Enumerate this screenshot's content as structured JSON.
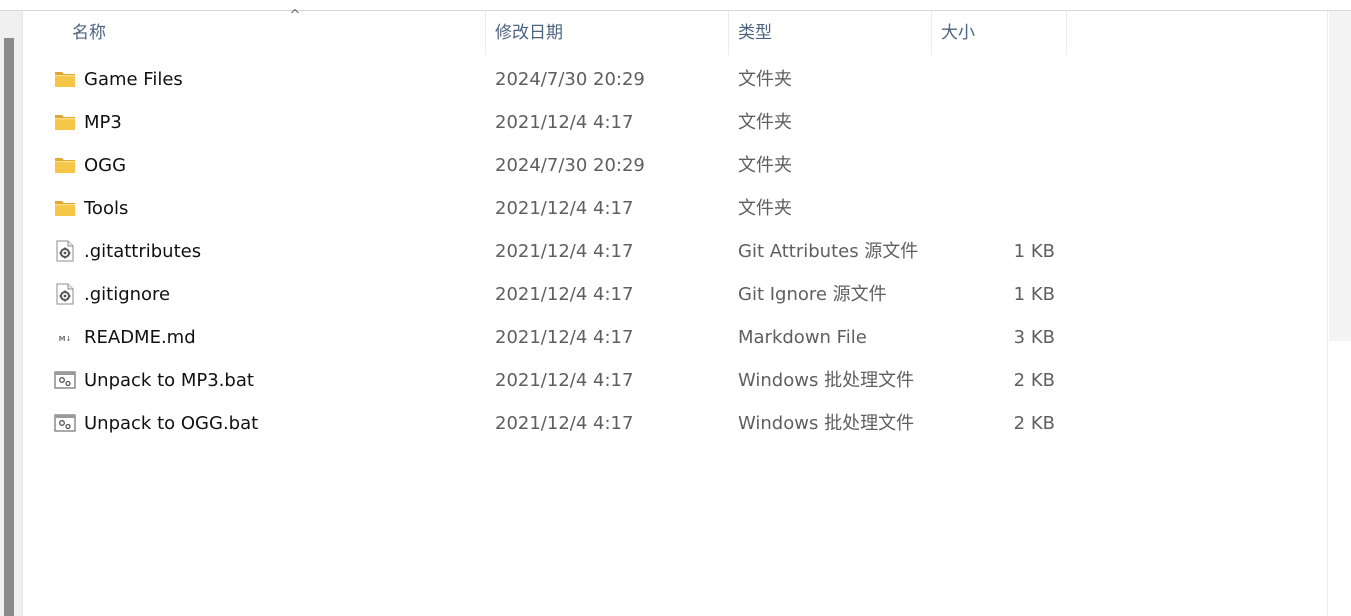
{
  "columns": {
    "name": "名称",
    "date": "修改日期",
    "type": "类型",
    "size": "大小"
  },
  "colors": {
    "folder": "#f6c648",
    "folder_dark": "#e0a82e",
    "header_text": "#4d6480"
  },
  "files": [
    {
      "name": "Game Files",
      "date": "2024/7/30 20:29",
      "type": "文件夹",
      "size": "",
      "icon": "folder-icon"
    },
    {
      "name": "MP3",
      "date": "2021/12/4 4:17",
      "type": "文件夹",
      "size": "",
      "icon": "folder-icon"
    },
    {
      "name": "OGG",
      "date": "2024/7/30 20:29",
      "type": "文件夹",
      "size": "",
      "icon": "folder-icon"
    },
    {
      "name": "Tools",
      "date": "2021/12/4 4:17",
      "type": "文件夹",
      "size": "",
      "icon": "folder-icon"
    },
    {
      "name": ".gitattributes",
      "date": "2021/12/4 4:17",
      "type": "Git Attributes 源文件",
      "size": "1 KB",
      "icon": "config-file-icon"
    },
    {
      "name": ".gitignore",
      "date": "2021/12/4 4:17",
      "type": "Git Ignore 源文件",
      "size": "1 KB",
      "icon": "config-file-icon"
    },
    {
      "name": "README.md",
      "date": "2021/12/4 4:17",
      "type": "Markdown File",
      "size": "3 KB",
      "icon": "markdown-file-icon"
    },
    {
      "name": "Unpack to MP3.bat",
      "date": "2021/12/4 4:17",
      "type": "Windows 批处理文件",
      "size": "2 KB",
      "icon": "batch-file-icon"
    },
    {
      "name": "Unpack to OGG.bat",
      "date": "2021/12/4 4:17",
      "type": "Windows 批处理文件",
      "size": "2 KB",
      "icon": "batch-file-icon"
    }
  ]
}
